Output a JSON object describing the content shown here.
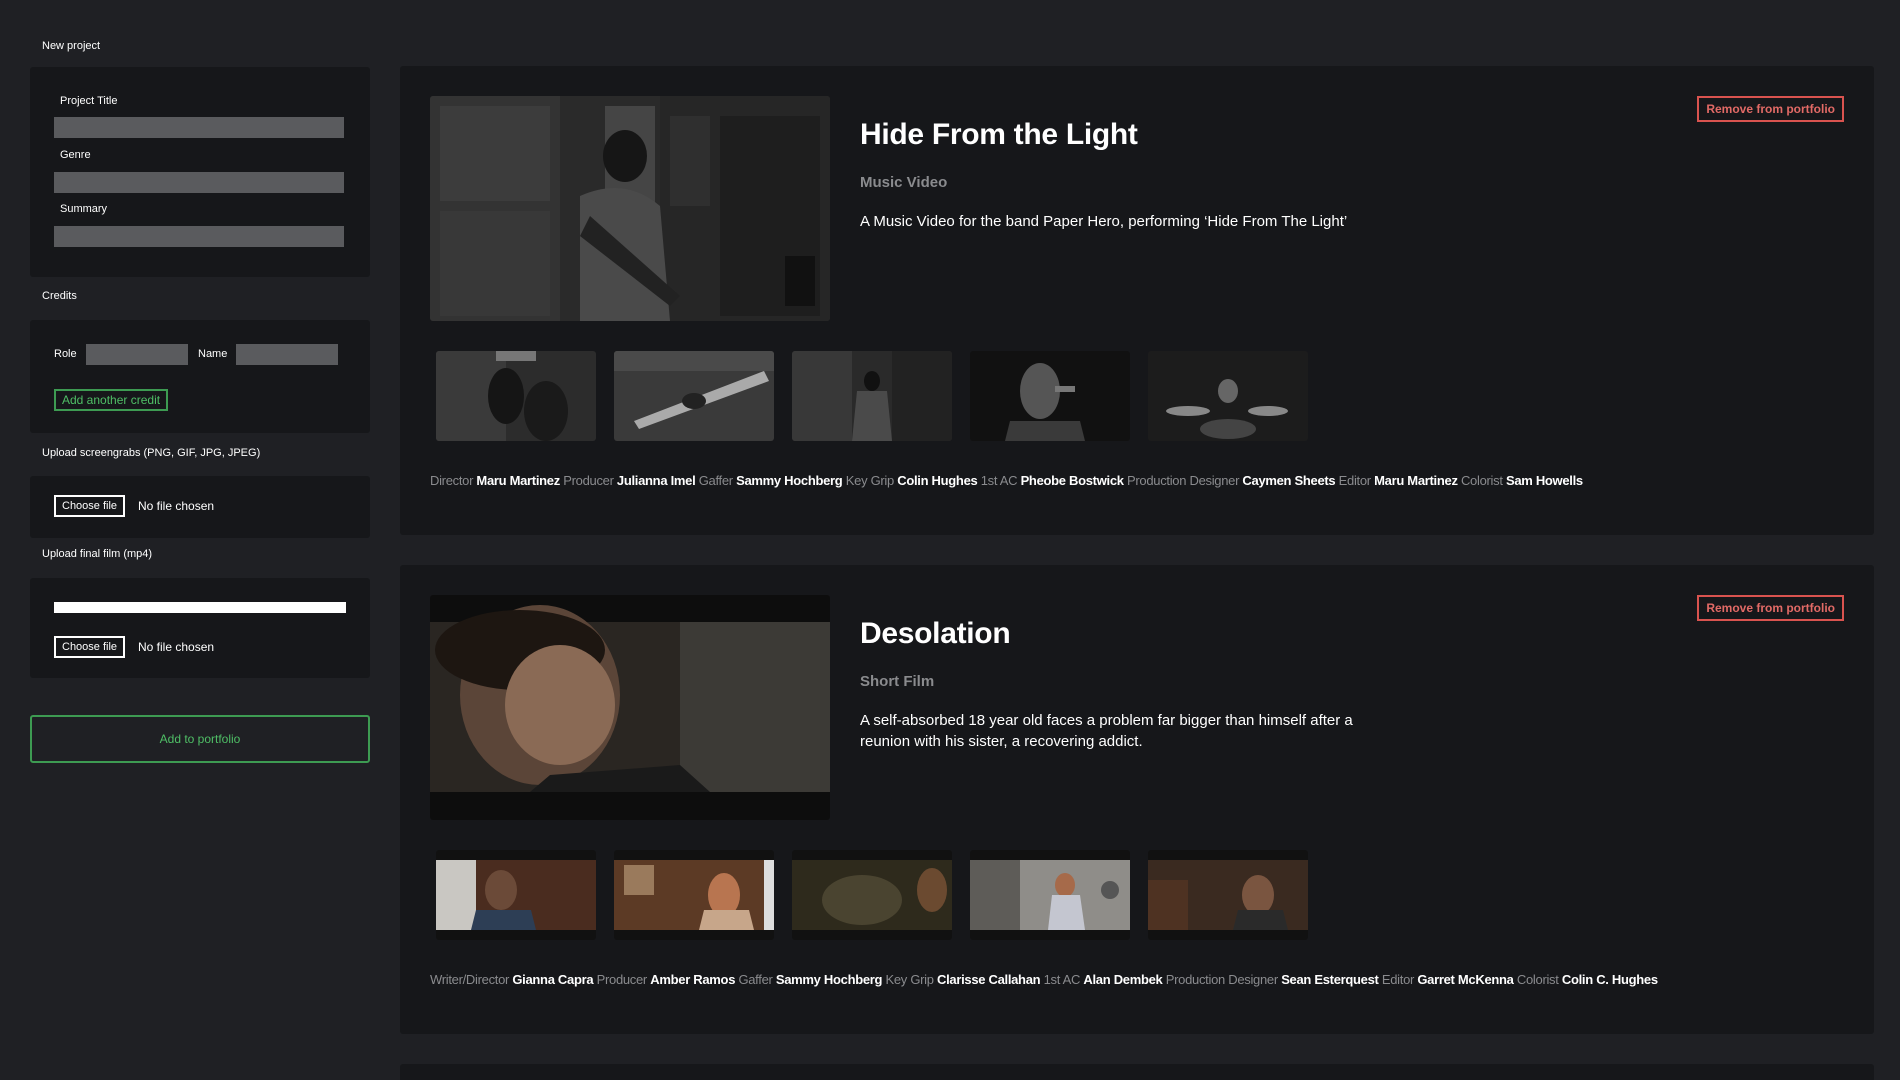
{
  "sidebar": {
    "new_project_label": "New project",
    "project_title_label": "Project Title",
    "genre_label": "Genre",
    "summary_label": "Summary",
    "credits_label": "Credits",
    "role_label": "Role",
    "name_label": "Name",
    "add_credit_label": "Add another credit",
    "screengrabs_label": "Upload screengrabs (PNG, GIF, JPG, JPEG)",
    "final_film_label": "Upload final film (mp4)",
    "choose_file_label": "Choose file",
    "no_file_label": "No file chosen",
    "upload_progress": 1.0,
    "add_to_portfolio_label": "Add to portfolio"
  },
  "projects": [
    {
      "title": "Hide From the Light",
      "genre": "Music Video",
      "summary": "A Music Video for the band Paper Hero, performing ‘Hide From The Light’",
      "remove_label": "Remove from portfolio",
      "credits": [
        {
          "role": "Director",
          "name": "Maru Martinez"
        },
        {
          "role": "Producer",
          "name": "Julianna Imel"
        },
        {
          "role": "Gaffer",
          "name": "Sammy Hochberg"
        },
        {
          "role": "Key Grip",
          "name": "Colin Hughes"
        },
        {
          "role": "1st AC",
          "name": "Pheobe Bostwick"
        },
        {
          "role": "Production Designer",
          "name": "Caymen Sheets"
        },
        {
          "role": "Editor",
          "name": "Maru Martinez"
        },
        {
          "role": "Colorist",
          "name": "Sam Howells"
        }
      ]
    },
    {
      "title": "Desolation",
      "genre": "Short Film",
      "summary": "A self-absorbed 18 year old faces a problem far bigger than himself after a reunion with his sister, a recovering addict.",
      "remove_label": "Remove from portfolio",
      "credits": [
        {
          "role": "Writer/Director",
          "name": "Gianna Capra"
        },
        {
          "role": "Producer",
          "name": "Amber Ramos"
        },
        {
          "role": "Gaffer",
          "name": "Sammy Hochberg"
        },
        {
          "role": "Key Grip",
          "name": "Clarisse Callahan"
        },
        {
          "role": "1st AC",
          "name": "Alan Dembek"
        },
        {
          "role": "Production Designer",
          "name": "Sean Esterquest"
        },
        {
          "role": "Editor",
          "name": "Garret McKenna"
        },
        {
          "role": "Colorist",
          "name": "Colin C. Hughes"
        }
      ]
    }
  ],
  "colors": {
    "page_bg": "#1f2024",
    "card_bg": "#16171a",
    "accent_green": "#4fbf66",
    "accent_red": "#e26a66",
    "muted_text": "#8a8b8e"
  }
}
